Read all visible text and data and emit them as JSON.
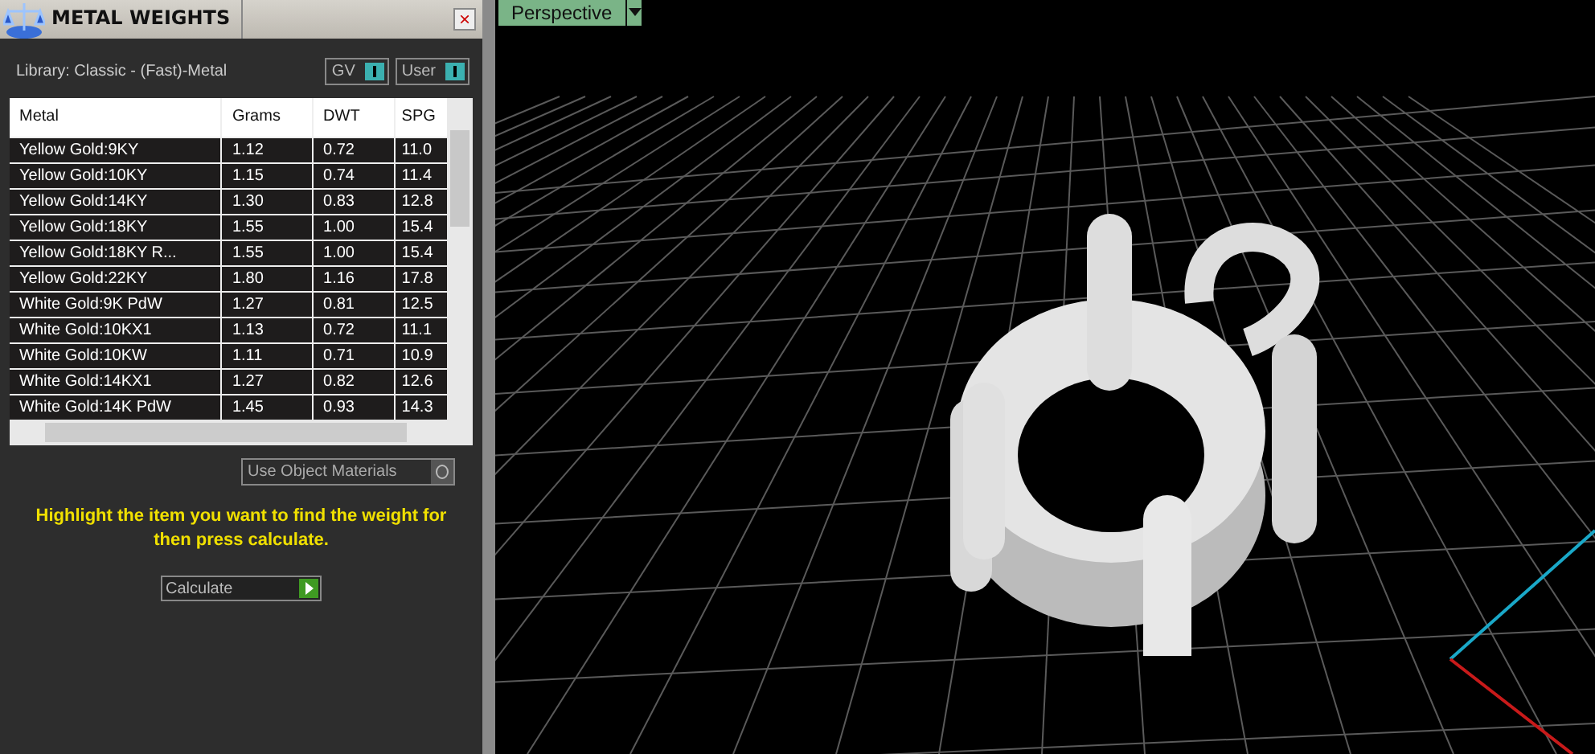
{
  "panel": {
    "title": "METAL WEIGHTS",
    "close": "×",
    "library": "Library: Classic - (Fast)-Metal",
    "toggles": [
      {
        "label": "GV",
        "on": true
      },
      {
        "label": "User",
        "on": true
      }
    ],
    "table": {
      "columns": [
        "Metal",
        "Grams",
        "DWT",
        "SPG"
      ],
      "rows": [
        [
          "Yellow Gold:9KY",
          "1.12",
          "0.72",
          "11.0"
        ],
        [
          "Yellow Gold:10KY",
          "1.15",
          "0.74",
          "11.4"
        ],
        [
          "Yellow Gold:14KY",
          "1.30",
          "0.83",
          "12.8"
        ],
        [
          "Yellow Gold:18KY",
          "1.55",
          "1.00",
          "15.4"
        ],
        [
          "Yellow Gold:18KY R...",
          "1.55",
          "1.00",
          "15.4"
        ],
        [
          "Yellow Gold:22KY",
          "1.80",
          "1.16",
          "17.8"
        ],
        [
          "White Gold:9K PdW",
          "1.27",
          "0.81",
          "12.5"
        ],
        [
          "White Gold:10KX1",
          "1.13",
          "0.72",
          "11.1"
        ],
        [
          "White Gold:10KW",
          "1.11",
          "0.71",
          "10.9"
        ],
        [
          "White Gold:14KX1",
          "1.27",
          "0.82",
          "12.6"
        ],
        [
          "White Gold:14K PdW",
          "1.45",
          "0.93",
          "14.3"
        ]
      ]
    },
    "object_materials": {
      "label": "Use Object Materials",
      "on": false
    },
    "hint": "Highlight the item you want to find the weight for then press calculate.",
    "calculate": "Calculate"
  },
  "viewport": {
    "label": "Perspective"
  }
}
